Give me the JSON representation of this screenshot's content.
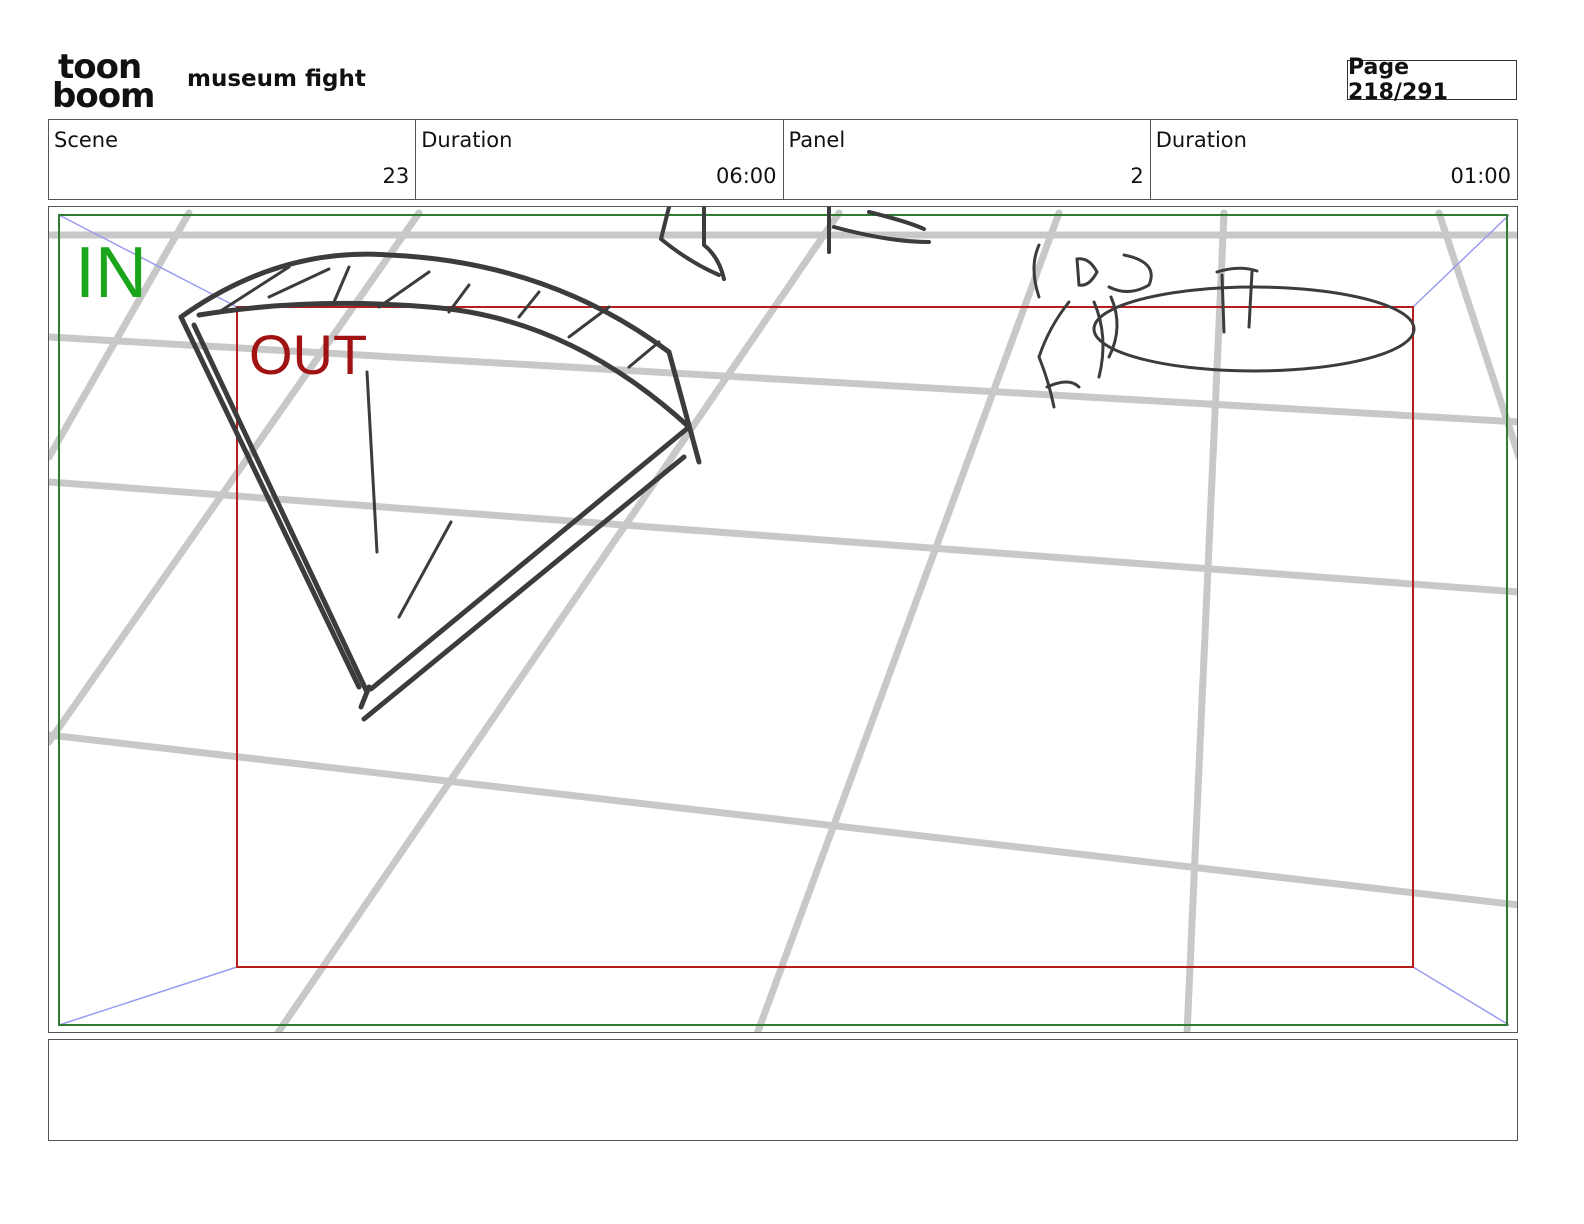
{
  "header": {
    "logo_line1": "toon",
    "logo_line2": "boom",
    "project_title": "museum fight",
    "page_indicator": "Page 218/291"
  },
  "info_bar": [
    {
      "label": "Scene",
      "value": "23"
    },
    {
      "label": "Duration",
      "value": "06:00"
    },
    {
      "label": "Panel",
      "value": "2"
    },
    {
      "label": "Duration",
      "value": "01:00"
    }
  ],
  "panel": {
    "in_label": "IN",
    "out_label": "OUT",
    "colors": {
      "in_frame": "#2e7d32",
      "out_frame": "#b71c1c",
      "in_text": "#1aa51a",
      "out_text": "#a11212",
      "grid": "#c8c8c8",
      "sketch": "#3c3c3c",
      "camera_arrows": "#9a9cf0"
    }
  },
  "caption": {
    "text": ""
  }
}
